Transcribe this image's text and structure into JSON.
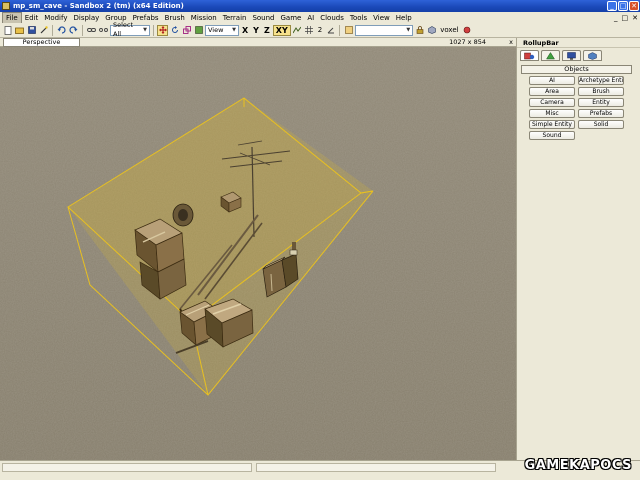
{
  "window": {
    "title": "mp_sm_cave - Sandbox 2 (tm) (x64 Edition)",
    "controls": [
      "_",
      "□",
      "✕"
    ]
  },
  "menubar": {
    "items": [
      "File",
      "Edit",
      "Modify",
      "Display",
      "Group",
      "Prefabs",
      "Brush",
      "Mission",
      "Terrain",
      "Sound",
      "Game",
      "AI",
      "Clouds",
      "Tools",
      "View",
      "Help"
    ],
    "active_index": 0,
    "mdi_controls": [
      "_",
      "□",
      "✕"
    ]
  },
  "toolbar": {
    "selection_combo": "Select All",
    "coord_combo": "View",
    "axes": [
      "X",
      "Y",
      "Z",
      "XY"
    ],
    "active_axis": "XY",
    "snap_value": "2",
    "layer_label": "voxel"
  },
  "viewport": {
    "title": "Perspective",
    "resolution": "1027 x 854",
    "close_glyph": "x"
  },
  "rollup": {
    "title": "RollupBar",
    "tab_icons": [
      "objects-tab-icon",
      "terrain-tab-icon",
      "display-tab-icon",
      "layers-tab-icon"
    ],
    "section_title": "Objects",
    "buttons": [
      "AI",
      "Archetype Entity",
      "Area",
      "Brush",
      "Camera",
      "Entity",
      "Misc",
      "Prefabs",
      "Simple Entity",
      "Solid",
      "Sound"
    ]
  },
  "watermark": "GAMEKAPOCS",
  "colors": {
    "title_bar": "#1a48b8",
    "selection_box": "#e8c020",
    "terrain": "#8a8270",
    "active_toggle": "#f7e28c"
  }
}
